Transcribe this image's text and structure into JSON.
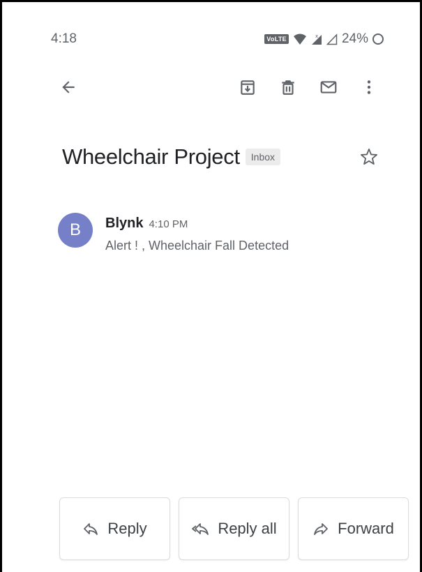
{
  "status_bar": {
    "time": "4:18",
    "volte": "VoLTE",
    "battery": "24%"
  },
  "toolbar": {
    "back_icon": "arrow-left-icon",
    "archive_icon": "archive-icon",
    "delete_icon": "trash-icon",
    "mark_unread_icon": "mail-icon",
    "more_icon": "more-vert-icon"
  },
  "thread": {
    "subject": "Wheelchair Project",
    "label": "Inbox",
    "star_icon": "star-outline-icon"
  },
  "message": {
    "avatar_letter": "B",
    "sender": "Blynk",
    "time": "4:10 PM",
    "snippet": "Alert ! , Wheelchair Fall Detected"
  },
  "actions": {
    "reply": "Reply",
    "reply_all": "Reply all",
    "forward": "Forward"
  },
  "colors": {
    "avatar": "#7580c9",
    "icon_gray": "#5f6368",
    "text": "#202124"
  }
}
